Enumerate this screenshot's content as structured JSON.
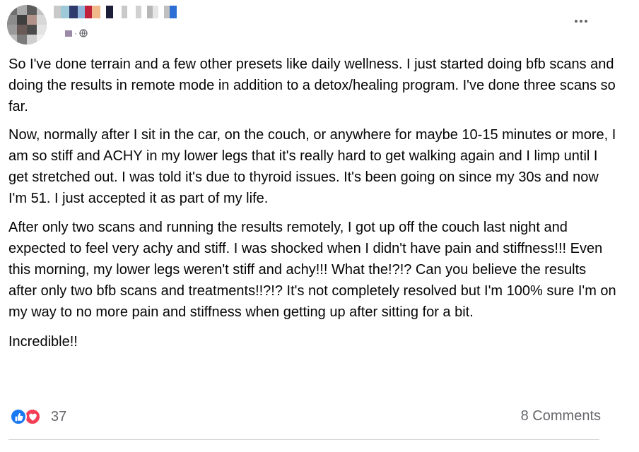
{
  "post": {
    "paragraphs": [
      "So I've done terrain and a few other presets like daily wellness. I just started doing bfb scans and doing the results in remote mode in addition to a detox/healing program. I've done three scans so far.",
      "Now, normally after I sit in the car, on the couch, or anywhere for maybe 10-15 minutes or more, I am so stiff and ACHY in my lower legs that it's really hard to get walking again and I limp until I get stretched out. I was told it's due to thyroid issues. It's been going on since my 30s and now I'm 51. I just accepted it as part of my life.",
      "After only two scans and running the results remotely, I got up off the couch last night and expected to feel very achy and stiff. I was shocked when I didn't have pain and stiffness!!! Even this morning, my lower legs weren't stiff and achy!!! What the!?!? Can you believe the results after only two bfb scans and treatments!!?!?  It's not completely resolved but I'm 100% sure I'm on my way to no more pain and stiffness when getting up after sitting for a bit.",
      "Incredible!!"
    ]
  },
  "footer": {
    "reaction_count": "37",
    "comments_label": "8 Comments"
  },
  "icons": {
    "like": "thumbs-up-icon",
    "love": "heart-icon",
    "privacy": "globe-icon",
    "menu": "more-options-icon"
  },
  "colors": {
    "like_blue": "#1877f2",
    "love_red": "#f33e58",
    "secondary_text": "#65676b"
  }
}
